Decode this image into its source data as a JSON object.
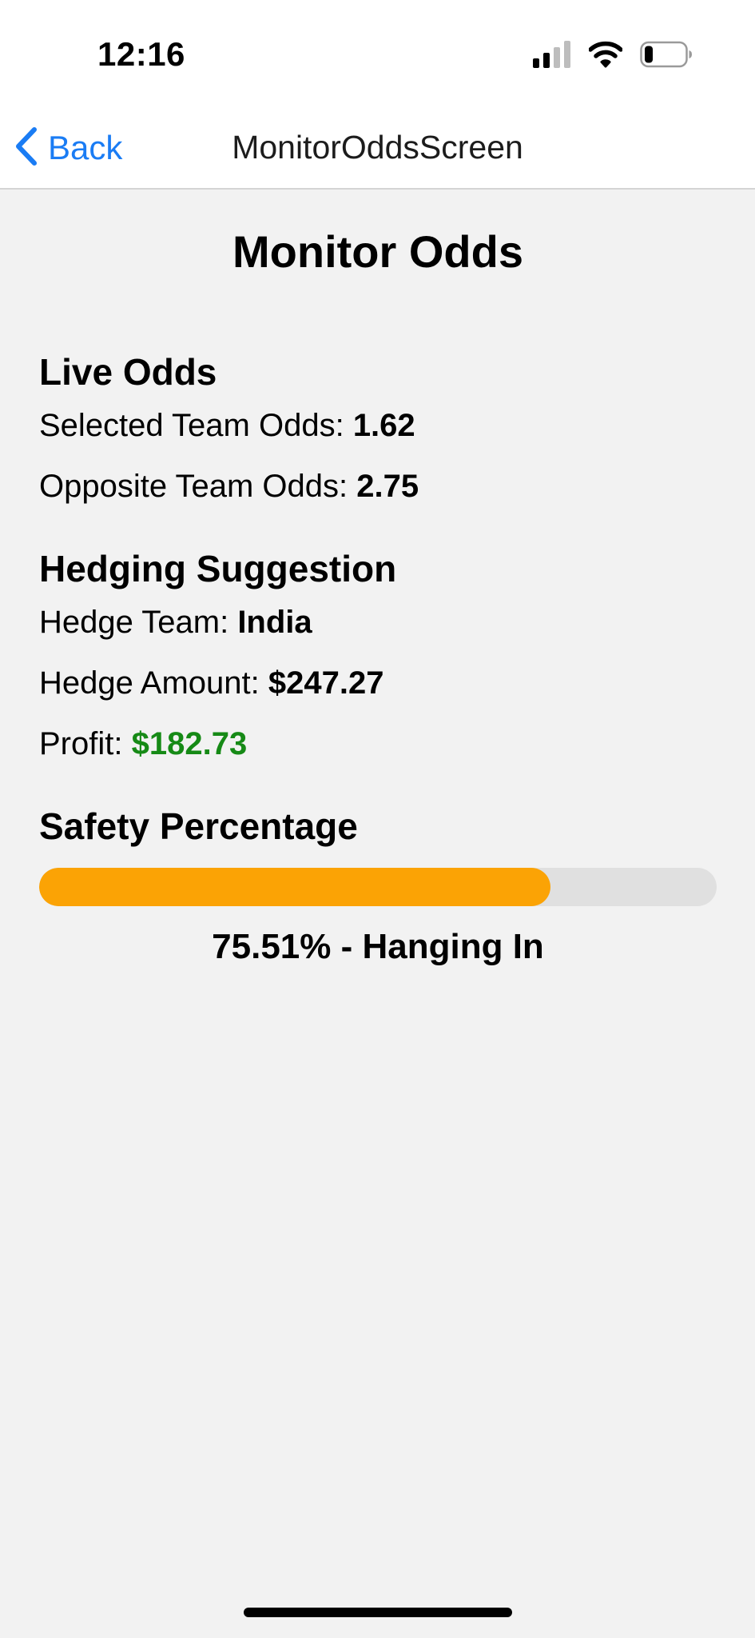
{
  "status_bar": {
    "time": "12:16",
    "icons": [
      "signal-icon",
      "wifi-icon",
      "battery-icon"
    ]
  },
  "nav": {
    "back_label": "Back",
    "title": "MonitorOddsScreen"
  },
  "page": {
    "title": "Monitor Odds"
  },
  "live_odds": {
    "heading": "Live Odds",
    "selected_label": "Selected Team Odds: ",
    "selected_value": "1.62",
    "opposite_label": "Opposite Team Odds: ",
    "opposite_value": "2.75"
  },
  "hedging": {
    "heading": "Hedging Suggestion",
    "team_label": "Hedge Team: ",
    "team_value": "India",
    "amount_label": "Hedge Amount: ",
    "amount_value": "$247.27",
    "profit_label": "Profit: ",
    "profit_value": "$182.73"
  },
  "safety": {
    "heading": "Safety Percentage",
    "percent": 75.51,
    "label": "75.51% - Hanging In"
  },
  "colors": {
    "accent_blue": "#1a7cf4",
    "profit_green": "#168a16",
    "progress_fill": "#fba305",
    "progress_track": "#e0e0e0"
  }
}
